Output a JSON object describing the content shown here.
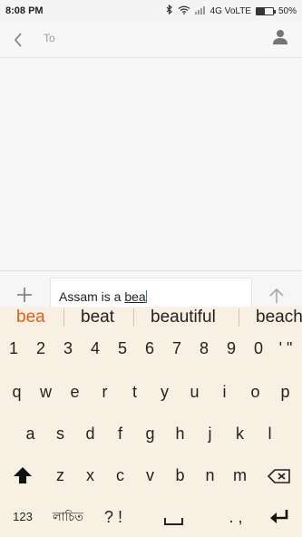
{
  "status_bar": {
    "time": "8:08 PM",
    "network": "4G VoLTE",
    "battery": "50%",
    "battery_level": 0.5
  },
  "header": {
    "to_placeholder": "To"
  },
  "compose": {
    "text_before": "Assam is a ",
    "composing": "bea"
  },
  "keyboard": {
    "suggestions": [
      "bea",
      "beat",
      "beautiful",
      "beach"
    ],
    "number_row": [
      "1",
      "2",
      "3",
      "4",
      "5",
      "6",
      "7",
      "8",
      "9",
      "0",
      "' \""
    ],
    "row1": [
      "q",
      "w",
      "e",
      "r",
      "t",
      "y",
      "u",
      "i",
      "o",
      "p"
    ],
    "row2": [
      "a",
      "s",
      "d",
      "f",
      "g",
      "h",
      "j",
      "k",
      "l"
    ],
    "row3": [
      "z",
      "x",
      "c",
      "v",
      "b",
      "n",
      "m"
    ],
    "bottom": {
      "numbers": "123",
      "language": "লাচিত",
      "symbols": "? !",
      "punct": ". ,"
    }
  }
}
